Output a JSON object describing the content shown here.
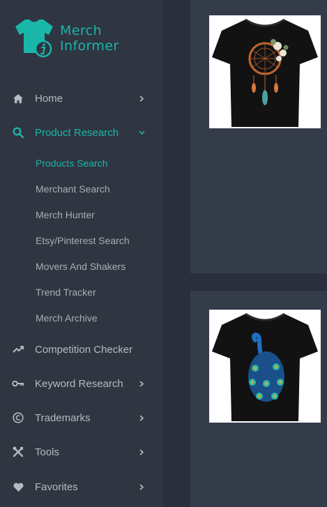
{
  "brand": {
    "line1": "Merch",
    "line2": "Informer",
    "color": "#1ab6a9"
  },
  "nav": {
    "home": {
      "label": "Home",
      "icon": "home-icon"
    },
    "product_research": {
      "label": "Product Research",
      "icon": "search-icon",
      "expanded": true,
      "sub": [
        {
          "label": "Products Search",
          "active": true
        },
        {
          "label": "Merchant Search"
        },
        {
          "label": "Merch Hunter"
        },
        {
          "label": "Etsy/Pinterest Search"
        },
        {
          "label": "Movers And Shakers"
        },
        {
          "label": "Trend Tracker"
        },
        {
          "label": "Merch Archive"
        }
      ]
    },
    "competition_checker": {
      "label": "Competition Checker",
      "icon": "trending-up-icon"
    },
    "keyword_research": {
      "label": "Keyword Research",
      "icon": "key-icon"
    },
    "trademarks": {
      "label": "Trademarks",
      "icon": "copyright-icon"
    },
    "tools": {
      "label": "Tools",
      "icon": "tools-icon"
    },
    "favorites": {
      "label": "Favorites",
      "icon": "heart-icon"
    }
  },
  "products": [
    {
      "image": "dreamcatcher-tshirt-image"
    },
    {
      "image": "peacock-tshirt-image"
    }
  ],
  "colors": {
    "accent": "#1ab6a9",
    "sidebar": "#2f3541",
    "card": "#353c49",
    "text": "#b5bac3"
  }
}
